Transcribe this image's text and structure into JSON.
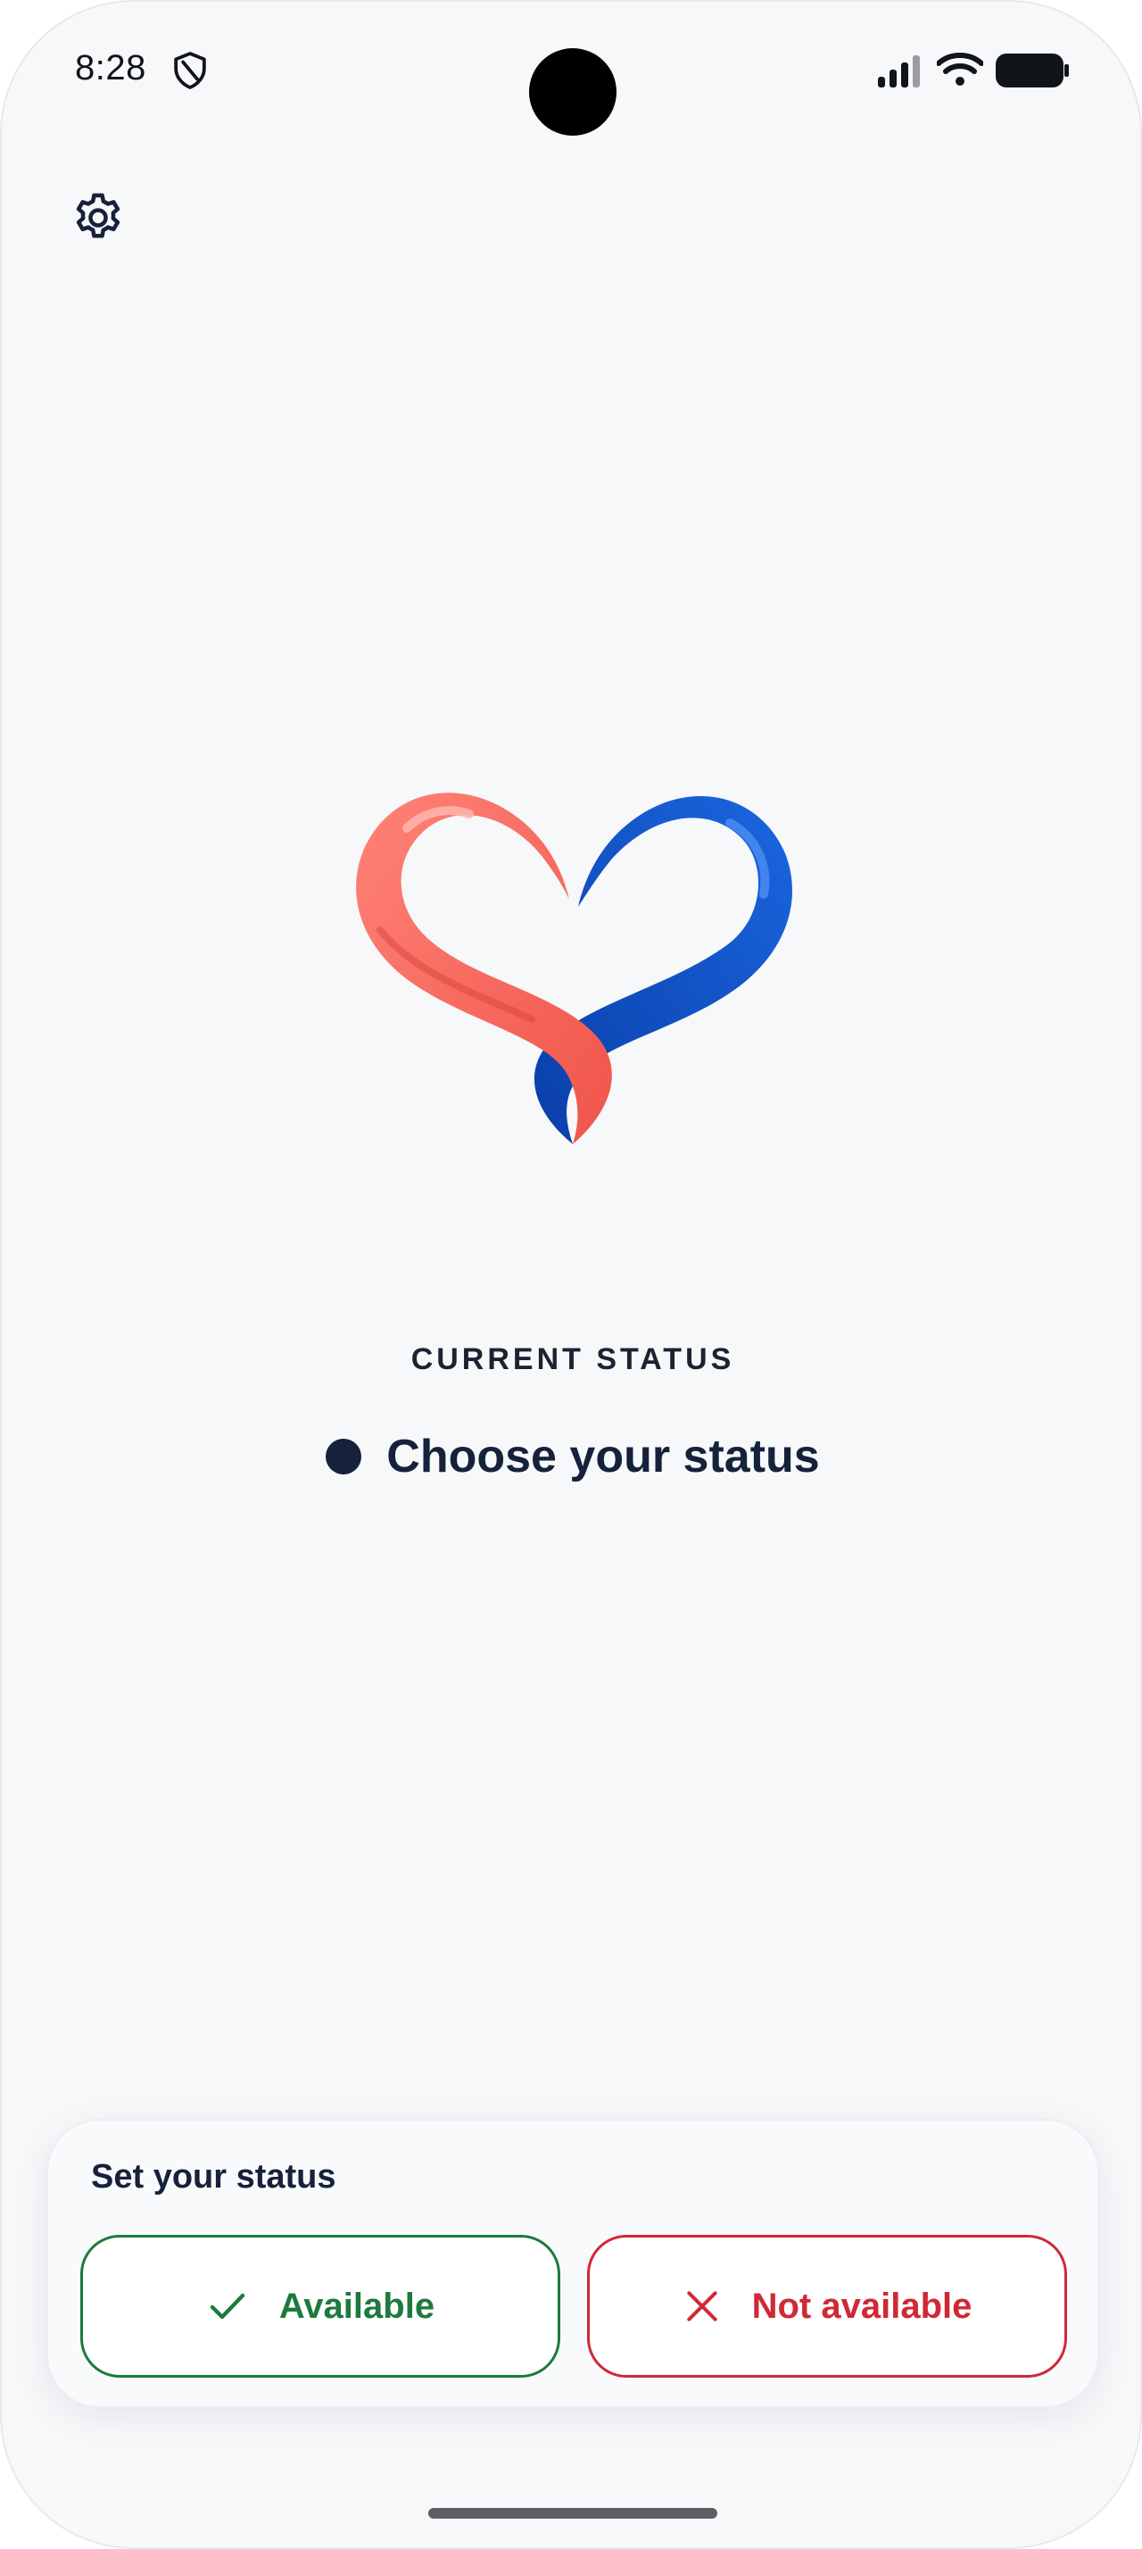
{
  "status_bar": {
    "time": "8:28",
    "icons": [
      "shield-icon",
      "signal-icon",
      "wifi-icon",
      "battery-icon"
    ]
  },
  "header": {
    "settings_icon": "gear-icon"
  },
  "logo": {
    "icon": "intertwined-heart-logo",
    "colors": {
      "left": "#ff6b5d",
      "right": "#0b4fc4"
    }
  },
  "status": {
    "label": "CURRENT STATUS",
    "value": "Choose your status"
  },
  "sheet": {
    "title": "Set your status",
    "available_label": "Available",
    "not_available_label": "Not available"
  },
  "colors": {
    "available": "#1d7a3d",
    "not_available": "#d02837",
    "text_primary": "#16213a",
    "background": "#f7f8fa"
  }
}
